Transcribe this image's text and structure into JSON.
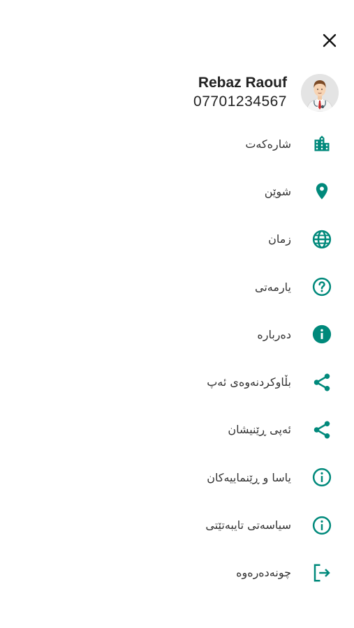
{
  "colors": {
    "accent": "#00897b",
    "text": "#333333",
    "background": "#ffffff"
  },
  "header": {
    "close_icon": "close-icon"
  },
  "profile": {
    "name": "Rebaz Raouf",
    "phone": "07701234567",
    "avatar_icon": "doctor-avatar"
  },
  "menu": {
    "items": [
      {
        "label": "شارەکەت",
        "icon": "city-icon"
      },
      {
        "label": "شوێن",
        "icon": "location-pin-icon"
      },
      {
        "label": "زمان",
        "icon": "globe-icon"
      },
      {
        "label": "یارمەتی",
        "icon": "help-icon"
      },
      {
        "label": "دەربارە",
        "icon": "info-icon"
      },
      {
        "label": "بڵاوکردنەوەی ئەپ",
        "icon": "share-icon"
      },
      {
        "label": "ئەپی ڕێنیشان",
        "icon": "share-icon"
      },
      {
        "label": "یاسا و ڕێنماییەکان",
        "icon": "info-outline-icon"
      },
      {
        "label": "سیاسەتی تایبەتێتی",
        "icon": "info-outline-icon"
      },
      {
        "label": "چونەدەرەوە",
        "icon": "logout-icon"
      }
    ]
  }
}
